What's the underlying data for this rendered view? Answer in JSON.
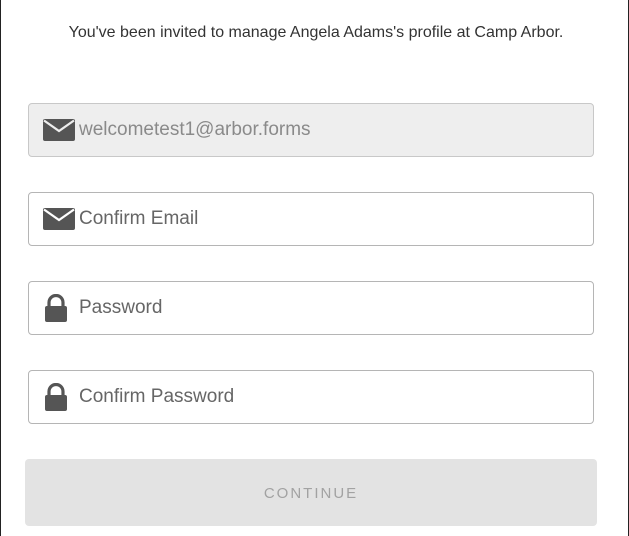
{
  "invite": {
    "message": "You've been invited to manage Angela Adams's profile at Camp Arbor."
  },
  "fields": {
    "email": {
      "value": "welcometest1@arbor.forms",
      "icon": "envelope-icon",
      "disabled": true
    },
    "confirm_email": {
      "placeholder": "Confirm Email",
      "icon": "envelope-icon"
    },
    "password": {
      "placeholder": "Password",
      "icon": "lock-icon"
    },
    "confirm_password": {
      "placeholder": "Confirm Password",
      "icon": "lock-icon"
    }
  },
  "continue_button": {
    "label": "CONTINUE",
    "disabled": true
  },
  "colors": {
    "icon": "#555555",
    "disabled_bg": "#eeeeee",
    "button_bg": "#e3e3e3",
    "button_text": "#a2a2a2"
  }
}
